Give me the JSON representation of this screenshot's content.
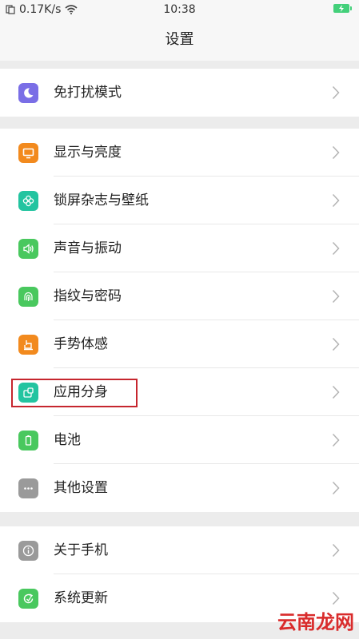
{
  "status_bar": {
    "speed": "0.17K/s",
    "time": "10:38"
  },
  "title": "设置",
  "groups": [
    {
      "items": [
        {
          "label": "免打扰模式",
          "icon": "moon-icon",
          "color": "#7a6ee6"
        }
      ]
    },
    {
      "items": [
        {
          "label": "显示与亮度",
          "icon": "display-icon",
          "color": "#f28a1e"
        },
        {
          "label": "锁屏杂志与壁纸",
          "icon": "flower-icon",
          "color": "#23c4a0"
        },
        {
          "label": "声音与振动",
          "icon": "speaker-icon",
          "color": "#49c85e"
        },
        {
          "label": "指纹与密码",
          "icon": "fingerprint-icon",
          "color": "#49c85e"
        },
        {
          "label": "手势体感",
          "icon": "hand-icon",
          "color": "#f28a1e"
        },
        {
          "label": "应用分身",
          "icon": "app-clone-icon",
          "color": "#23c4a0"
        },
        {
          "label": "电池",
          "icon": "battery-icon",
          "color": "#49c85e"
        },
        {
          "label": "其他设置",
          "icon": "more-icon",
          "color": "#9a9a9a"
        }
      ]
    },
    {
      "items": [
        {
          "label": "关于手机",
          "icon": "info-icon",
          "color": "#9a9a9a"
        },
        {
          "label": "系统更新",
          "icon": "update-icon",
          "color": "#49c85e"
        }
      ]
    }
  ],
  "watermark": "云南龙网"
}
